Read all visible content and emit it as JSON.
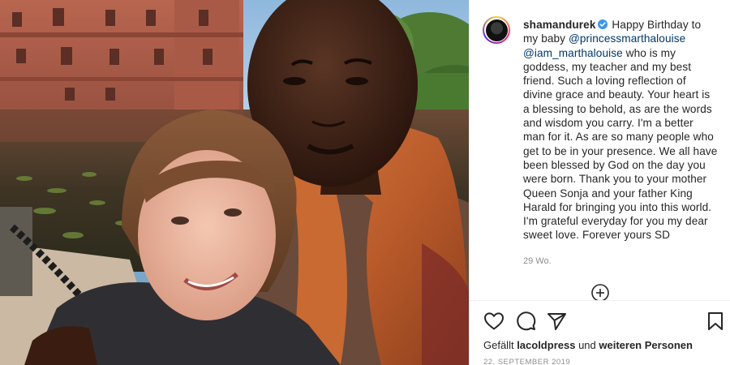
{
  "post": {
    "username": "shamandurek",
    "caption_intro": " Happy Birthday to my baby ",
    "mention_1": "@princessmarthalouise",
    "mention_2": "@iam_marthalouise",
    "caption_body": " who is my goddess, my teacher and my best friend. Such a loving reflection of divine grace and beauty. Your heart is a blessing to behold, as are the words and wisdom you carry. I'm a better man for it. As are so many people who get to be in your presence. We all have been blessed by God on the day you were born. Thank you to your mother Queen Sonja and your father King Harald for bringing you into this world. I'm grateful everyday for you my dear sweet love. Forever yours SD",
    "time_ago": "29 Wo.",
    "likes_prefix": "Gefällt ",
    "likes_user": "lacoldpress",
    "likes_middle": " und ",
    "likes_others": "weiteren Personen",
    "date": "22. SEPTEMBER 2019"
  },
  "icons": {
    "verified": "verified-badge-icon",
    "load_more": "plus-circle-icon",
    "like": "heart-icon",
    "comment": "comment-icon",
    "share": "paper-plane-icon",
    "save": "bookmark-icon"
  },
  "colors": {
    "verified": "#3897f0",
    "mention": "#00376b",
    "text": "#262626",
    "muted": "#8e8e8e"
  }
}
